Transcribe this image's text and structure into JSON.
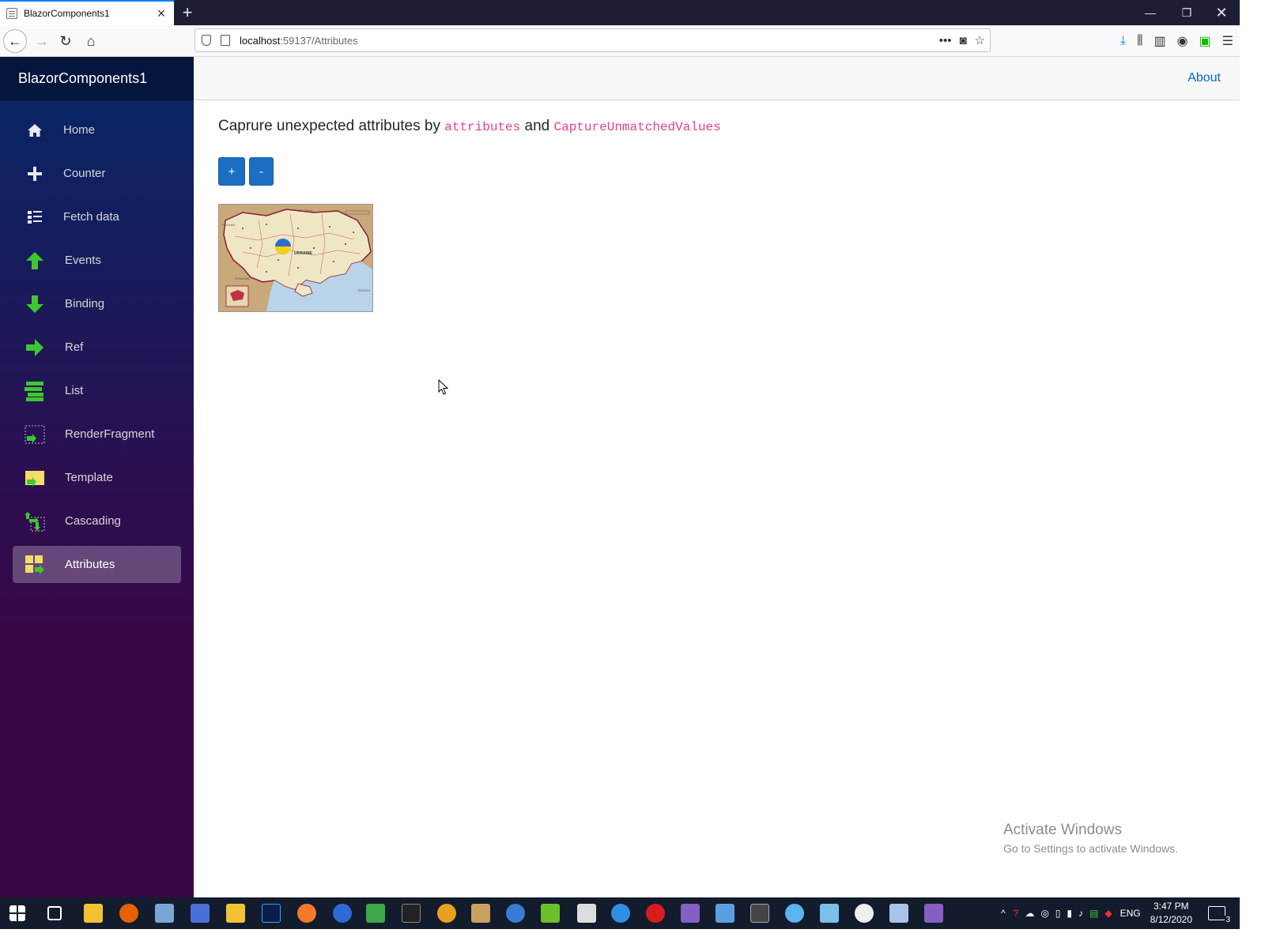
{
  "browser": {
    "tab_title": "BlazorComponents1",
    "url_host": "localhost",
    "url_path": ":59137/Attributes"
  },
  "app": {
    "brand": "BlazorComponents1",
    "about_label": "About",
    "nav_items": [
      {
        "label": "Home",
        "icon": "home-icon"
      },
      {
        "label": "Counter",
        "icon": "plus-icon"
      },
      {
        "label": "Fetch data",
        "icon": "list-icon"
      },
      {
        "label": "Events",
        "icon": "arrow-up-icon"
      },
      {
        "label": "Binding",
        "icon": "arrow-down-icon"
      },
      {
        "label": "Ref",
        "icon": "arrow-right-icon"
      },
      {
        "label": "List",
        "icon": "stacked-list-icon"
      },
      {
        "label": "RenderFragment",
        "icon": "render-fragment-icon"
      },
      {
        "label": "Template",
        "icon": "template-icon"
      },
      {
        "label": "Cascading",
        "icon": "cascading-icon"
      },
      {
        "label": "Attributes",
        "icon": "attributes-icon",
        "active": true
      }
    ]
  },
  "main": {
    "heading_prefix": "Caprure unexpected attributes by",
    "heading_code1": "attributes",
    "heading_and": "and",
    "heading_code2": "CaptureUnmatchedValues",
    "plus_label": "+",
    "minus_label": "-",
    "map_image": "ukraine-map",
    "map_labels": {
      "belarus": "BELARUS",
      "country": "UKRAINE",
      "romania": "ROMANIA",
      "russia": "RUSSIA",
      "poland": "POLAND"
    }
  },
  "watermark": {
    "title": "Activate Windows",
    "subtitle": "Go to Settings to activate Windows."
  },
  "taskbar": {
    "lang": "ENG",
    "time": "3:47 PM",
    "date": "8/12/2020",
    "notifications": "3"
  },
  "colors": {
    "sidebar_top": "#052767",
    "sidebar_bottom": "#3a0647",
    "button": "#1b6ec2",
    "link": "#0366d6",
    "code": "#e83e8c",
    "icon_green": "#3ec72f"
  }
}
